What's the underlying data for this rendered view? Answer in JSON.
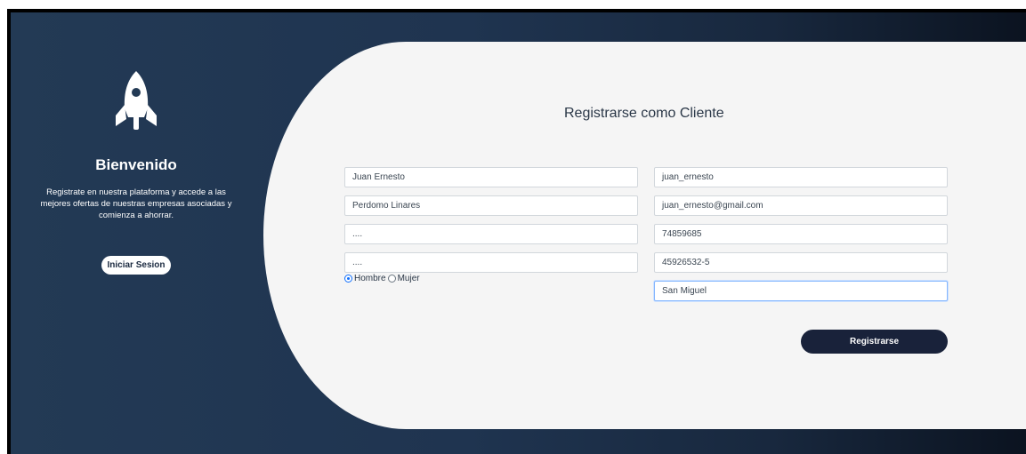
{
  "sidebar": {
    "title": "Bienvenido",
    "description": "Registrate en nuestra plataforma y accede a las mejores ofertas de nuestras empresas asociadas y comienza a ahorrar.",
    "login_button": "Iniciar Sesion",
    "logo_icon": "rocket-icon"
  },
  "form": {
    "title": "Registrarse como Cliente",
    "fields": {
      "first_name": "Juan Ernesto",
      "last_name": "Perdomo Linares",
      "password": "....",
      "confirm_password": "....",
      "username": "juan_ernesto",
      "email": "juan_ernesto@gmail.com",
      "phone": "74859685",
      "document": "45926532-5",
      "city": "San Miguel"
    },
    "gender": {
      "options": [
        "Hombre",
        "Mujer"
      ],
      "selected": "Hombre"
    },
    "submit_button": "Registrarse"
  },
  "colors": {
    "sidebar_bg": "#233a55",
    "form_bg": "#f5f5f5",
    "button_dark": "#19223a",
    "focus_border": "#86b7fe"
  }
}
